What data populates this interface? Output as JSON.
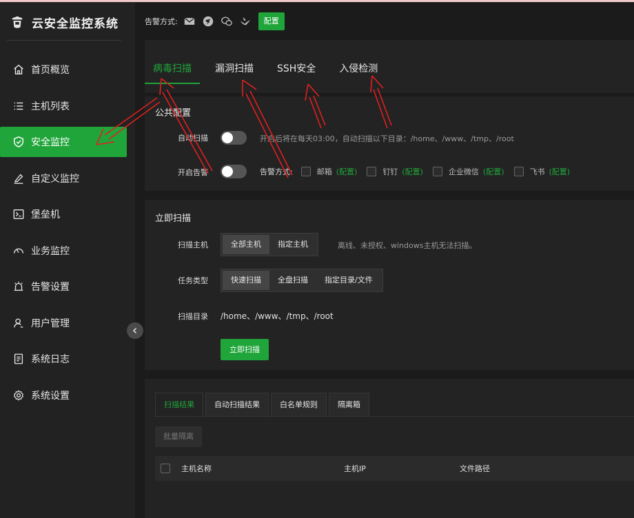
{
  "app": {
    "title": "云安全监控系统"
  },
  "alert_bar": {
    "label": "告警方式:",
    "icons": [
      "mail-icon",
      "dingtalk-icon",
      "wechat-icon",
      "feishu-icon"
    ],
    "config_button": "配置"
  },
  "sidebar": {
    "items": [
      {
        "label": "首页概览",
        "icon": "home-icon",
        "active": false
      },
      {
        "label": "主机列表",
        "icon": "list-icon",
        "active": false
      },
      {
        "label": "安全监控",
        "icon": "shield-icon",
        "active": true
      },
      {
        "label": "自定义监控",
        "icon": "edit-icon",
        "active": false
      },
      {
        "label": "堡垒机",
        "icon": "terminal-icon",
        "active": false
      },
      {
        "label": "业务监控",
        "icon": "gauge-icon",
        "active": false
      },
      {
        "label": "告警设置",
        "icon": "alarm-icon",
        "active": false
      },
      {
        "label": "用户管理",
        "icon": "user-icon",
        "active": false
      },
      {
        "label": "系统日志",
        "icon": "log-icon",
        "active": false
      },
      {
        "label": "系统设置",
        "icon": "gear-icon",
        "active": false
      }
    ]
  },
  "tabs": [
    {
      "label": "病毒扫描",
      "active": true
    },
    {
      "label": "漏洞扫描",
      "active": false
    },
    {
      "label": "SSH安全",
      "active": false
    },
    {
      "label": "入侵检测",
      "active": false
    }
  ],
  "public_config": {
    "title": "公共配置",
    "auto_scan_label": "自动扫描",
    "auto_scan_hint": "开启后将在每天03:00，自动扫描以下目录：/home、/www、/tmp、/root",
    "alert_label": "开启告警",
    "alert_method_label": "告警方式:",
    "channels": [
      {
        "label": "邮箱",
        "config": "(配置)"
      },
      {
        "label": "钉钉",
        "config": "(配置)"
      },
      {
        "label": "企业微信",
        "config": "(配置)"
      },
      {
        "label": "飞书",
        "config": "(配置)"
      }
    ]
  },
  "scan_now": {
    "title": "立即扫描",
    "host_label": "扫描主机",
    "host_options": [
      "全部主机",
      "指定主机"
    ],
    "host_selected": "全部主机",
    "host_hint": "离线、未授权、windows主机无法扫描。",
    "task_label": "任务类型",
    "task_options": [
      "快速扫描",
      "全盘扫描",
      "指定目录/文件"
    ],
    "task_selected": "快速扫描",
    "dir_label": "扫描目录",
    "dir_value": "/home、/www、/tmp、/root",
    "scan_button": "立即扫描"
  },
  "results": {
    "tabs": [
      {
        "label": "扫描结果",
        "active": true
      },
      {
        "label": "自动扫描结果",
        "active": false
      },
      {
        "label": "白名单规则",
        "active": false
      },
      {
        "label": "隔离箱",
        "active": false
      }
    ],
    "batch_button": "批量隔离",
    "columns": [
      "主机名称",
      "主机IP",
      "文件路径"
    ]
  },
  "colors": {
    "accent": "#20a53a",
    "annotation": "#e02020"
  }
}
